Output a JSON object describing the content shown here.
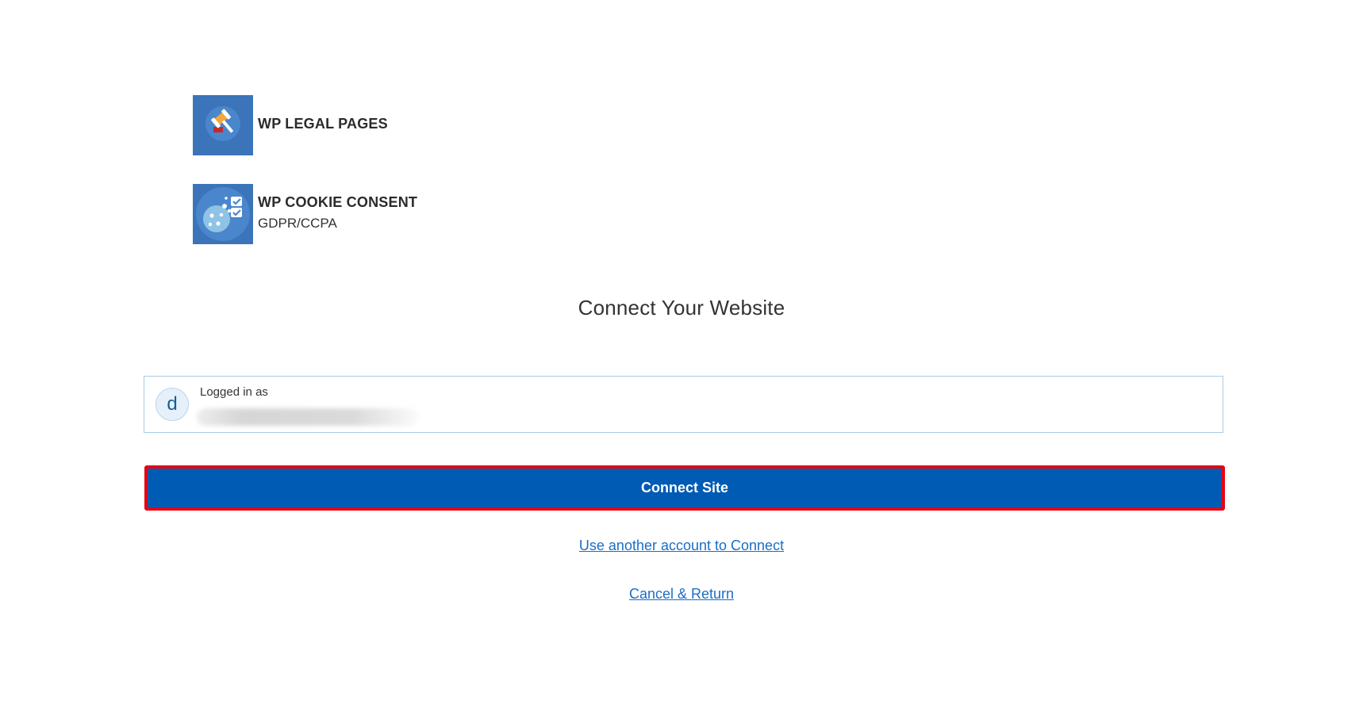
{
  "products": [
    {
      "name": "WP LEGAL PAGES",
      "subtitle": "",
      "icon": "gavel-icon"
    },
    {
      "name": "WP COOKIE CONSENT",
      "subtitle": "GDPR/CCPA",
      "icon": "cookie-checklist-icon"
    }
  ],
  "title": "Connect Your Website",
  "account": {
    "label": "Logged in as",
    "avatar_letter": "d"
  },
  "actions": {
    "connect_label": "Connect Site",
    "other_account_label": "Use another account to Connect",
    "cancel_label": "Cancel & Return"
  },
  "colors": {
    "primary_button": "#005bb5",
    "highlight_border": "#e30613",
    "link": "#1a6ec7",
    "logo_background": "#3b74b8"
  }
}
